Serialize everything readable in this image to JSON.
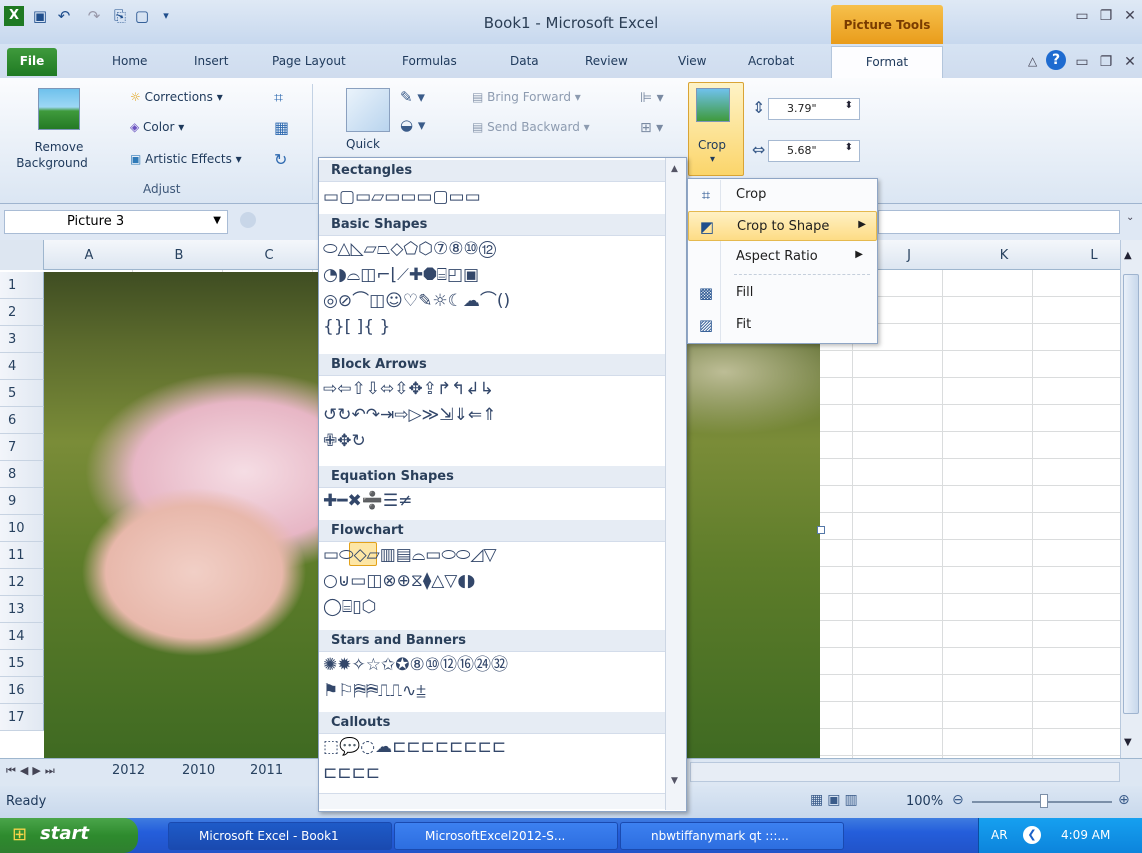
{
  "window": {
    "title": "Book1  -  Microsoft Excel",
    "context_tab_group": "Picture Tools"
  },
  "tabs": [
    "File",
    "Home",
    "Insert",
    "Page Layout",
    "Formulas",
    "Data",
    "Review",
    "View",
    "Acrobat",
    "Format"
  ],
  "ribbon": {
    "remove_background": [
      "Remove",
      "Background"
    ],
    "corrections": "Corrections",
    "color": "Color",
    "artistic_effects": "Artistic Effects",
    "adjust_label": "Adjust",
    "quick_styles": "Quick",
    "bring_forward": "Bring Forward",
    "send_backward": "Send Backward",
    "crop": "Crop",
    "height": "3.79\"",
    "width": "5.68\""
  },
  "name_box": "Picture 3",
  "columns": [
    "A",
    "B",
    "C",
    "J",
    "K",
    "L"
  ],
  "rows": [
    "1",
    "2",
    "3",
    "4",
    "5",
    "6",
    "7",
    "8",
    "9",
    "10",
    "11",
    "12",
    "13",
    "14",
    "15",
    "16",
    "17"
  ],
  "sheet_tabs": [
    "2012",
    "2010",
    "2011"
  ],
  "status": {
    "ready": "Ready",
    "zoom": "100%"
  },
  "shapes_gallery": {
    "categories": [
      "Rectangles",
      "Basic Shapes",
      "Block Arrows",
      "Equation Shapes",
      "Flowchart",
      "Stars and Banners",
      "Callouts"
    ]
  },
  "crop_menu": {
    "items": [
      "Crop",
      "Crop to Shape",
      "Aspect Ratio",
      "Fill",
      "Fit"
    ]
  },
  "taskbar": {
    "start": "start",
    "items": [
      "Microsoft Excel - Book1",
      "MicrosoftExcel2012-S...",
      "nbwtiffanymark qt :::..."
    ],
    "lang": "AR",
    "time": "4:09 AM"
  }
}
